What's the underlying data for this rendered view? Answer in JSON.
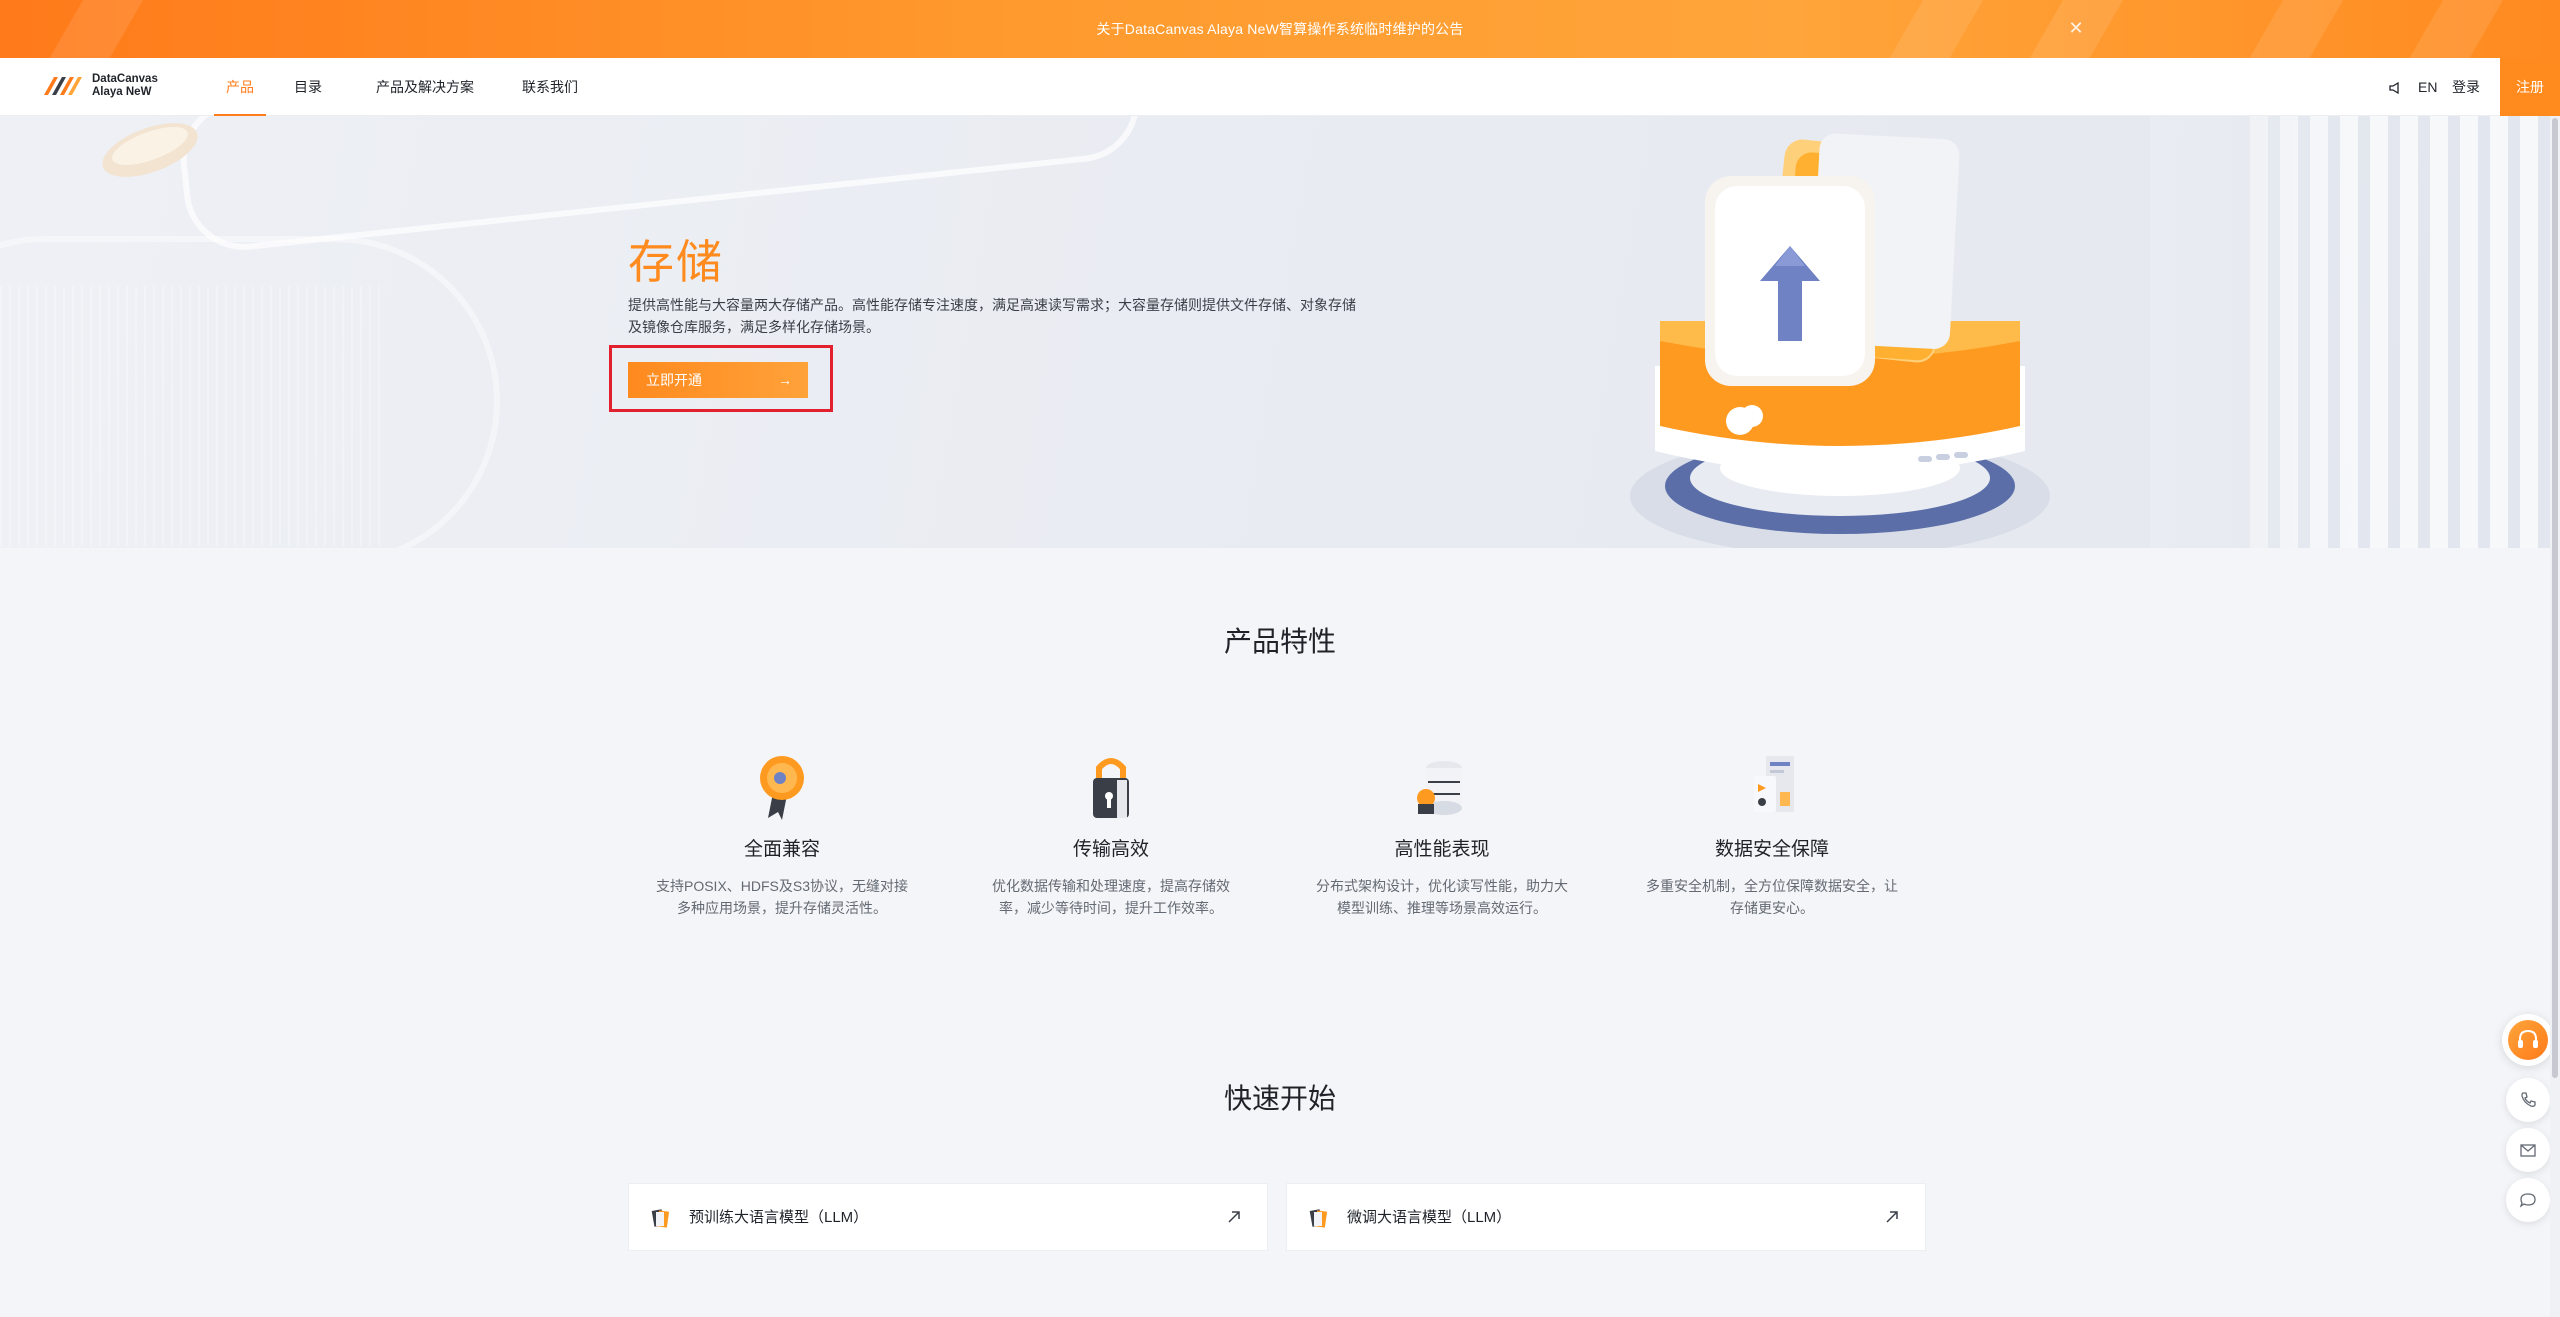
{
  "announcement": {
    "text": "关于DataCanvas Alaya NeW智算操作系统临时维护的公告"
  },
  "header": {
    "logo_line1": "DataCanvas",
    "logo_line2": "Alaya NeW",
    "nav": [
      {
        "label": "产品",
        "active": true
      },
      {
        "label": "目录"
      },
      {
        "label": "产品及解决方案"
      },
      {
        "label": "联系我们"
      }
    ],
    "lang": "EN",
    "login": "登录",
    "register": "注册"
  },
  "hero": {
    "title": "存储",
    "description": "提供高性能与大容量两大存储产品。高性能存储专注速度，满足高速读写需求；大容量存储则提供文件存储、对象存储及镜像仓库服务，满足多样化存储场景。",
    "cta_label": "立即开通",
    "cta_arrow": "→"
  },
  "features": {
    "title": "产品特性",
    "items": [
      {
        "name": "全面兼容",
        "desc": "支持POSIX、HDFS及S3协议，无缝对接多种应用场景，提升存储灵活性。",
        "icon": "medal-icon"
      },
      {
        "name": "传输高效",
        "desc": "优化数据传输和处理速度，提高存储效率，减少等待时间，提升工作效率。",
        "icon": "lock-icon"
      },
      {
        "name": "高性能表现",
        "desc": "分布式架构设计，优化读写性能，助力大模型训练、推理等场景高效运行。",
        "icon": "server-icon"
      },
      {
        "name": "数据安全保障",
        "desc": "多重安全机制，全方位保障数据安全，让存储更安心。",
        "icon": "document-shield-icon"
      }
    ]
  },
  "quickstart": {
    "title": "快速开始",
    "cards": [
      {
        "label": "预训练大语言模型（LLM）"
      },
      {
        "label": "微调大语言模型（LLM）"
      }
    ]
  },
  "colors": {
    "accent": "#ff8a1e",
    "highlight_border": "#e2202e"
  }
}
